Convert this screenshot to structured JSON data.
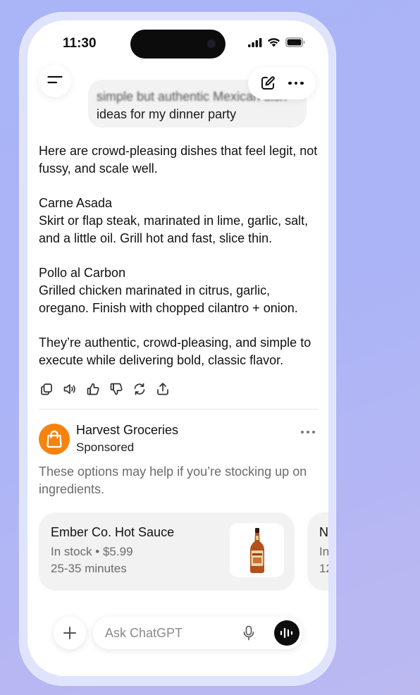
{
  "status_bar": {
    "time": "11:30",
    "icons": [
      "cellular-signal-icon",
      "wifi-icon",
      "battery-icon"
    ]
  },
  "header": {
    "menu_icon": "menu-icon",
    "new_chat_icon": "compose-icon",
    "more_icon": "more-icon"
  },
  "conversation": {
    "user_message": {
      "line1": "simple but authentic Mexican dish",
      "line2": "ideas for my dinner party"
    },
    "assistant_reply": {
      "intro": "Here are crowd-pleasing dishes that feel legit, not fussy, and scale well.",
      "dishes": [
        {
          "name": "Carne Asada",
          "description": "Skirt or flap steak, marinated in lime, garlic, salt, and a little oil. Grill hot and fast, slice thin."
        },
        {
          "name": "Pollo al Carbon",
          "description": "Grilled chicken marinated in citrus, garlic, oregano. Finish with chopped cilantro + onion."
        }
      ],
      "closing": "They’re authentic, crowd-pleasing, and simple to execute while delivering bold, classic flavor."
    },
    "action_icons": [
      "copy-icon",
      "read-aloud-icon",
      "thumbs-up-icon",
      "thumbs-down-icon",
      "regenerate-icon",
      "share-icon"
    ]
  },
  "ad": {
    "brand_name": "Harvest Groceries",
    "sponsored_label": "Sponsored",
    "brand_color": "#f5830f",
    "blurb": "These options may help if you’re stocking up on ingredients.",
    "products": [
      {
        "name": "Ember Co. Hot Sauce",
        "meta": "In stock • $5.99",
        "eta": "25-35 minutes"
      },
      {
        "name": "N",
        "meta": "In",
        "eta": "12"
      }
    ]
  },
  "composer": {
    "placeholder": "Ask ChatGPT",
    "value": "",
    "add_icon": "plus-icon",
    "mic_icon": "microphone-icon",
    "voice_icon": "voice-mode-icon"
  }
}
